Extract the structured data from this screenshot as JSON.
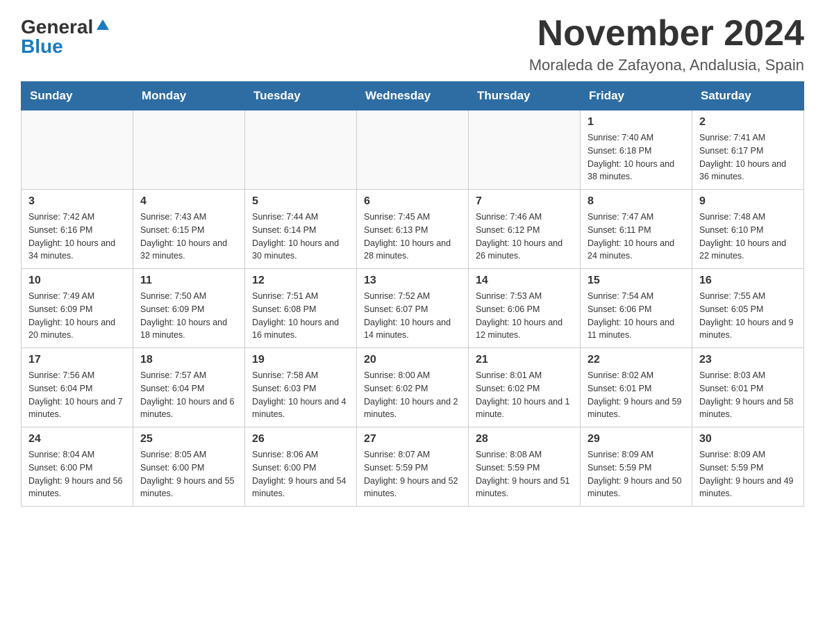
{
  "logo": {
    "general": "General",
    "blue": "Blue"
  },
  "title": "November 2024",
  "subtitle": "Moraleda de Zafayona, Andalusia, Spain",
  "days_of_week": [
    "Sunday",
    "Monday",
    "Tuesday",
    "Wednesday",
    "Thursday",
    "Friday",
    "Saturday"
  ],
  "weeks": [
    [
      {
        "day": "",
        "info": ""
      },
      {
        "day": "",
        "info": ""
      },
      {
        "day": "",
        "info": ""
      },
      {
        "day": "",
        "info": ""
      },
      {
        "day": "",
        "info": ""
      },
      {
        "day": "1",
        "info": "Sunrise: 7:40 AM\nSunset: 6:18 PM\nDaylight: 10 hours and 38 minutes."
      },
      {
        "day": "2",
        "info": "Sunrise: 7:41 AM\nSunset: 6:17 PM\nDaylight: 10 hours and 36 minutes."
      }
    ],
    [
      {
        "day": "3",
        "info": "Sunrise: 7:42 AM\nSunset: 6:16 PM\nDaylight: 10 hours and 34 minutes."
      },
      {
        "day": "4",
        "info": "Sunrise: 7:43 AM\nSunset: 6:15 PM\nDaylight: 10 hours and 32 minutes."
      },
      {
        "day": "5",
        "info": "Sunrise: 7:44 AM\nSunset: 6:14 PM\nDaylight: 10 hours and 30 minutes."
      },
      {
        "day": "6",
        "info": "Sunrise: 7:45 AM\nSunset: 6:13 PM\nDaylight: 10 hours and 28 minutes."
      },
      {
        "day": "7",
        "info": "Sunrise: 7:46 AM\nSunset: 6:12 PM\nDaylight: 10 hours and 26 minutes."
      },
      {
        "day": "8",
        "info": "Sunrise: 7:47 AM\nSunset: 6:11 PM\nDaylight: 10 hours and 24 minutes."
      },
      {
        "day": "9",
        "info": "Sunrise: 7:48 AM\nSunset: 6:10 PM\nDaylight: 10 hours and 22 minutes."
      }
    ],
    [
      {
        "day": "10",
        "info": "Sunrise: 7:49 AM\nSunset: 6:09 PM\nDaylight: 10 hours and 20 minutes."
      },
      {
        "day": "11",
        "info": "Sunrise: 7:50 AM\nSunset: 6:09 PM\nDaylight: 10 hours and 18 minutes."
      },
      {
        "day": "12",
        "info": "Sunrise: 7:51 AM\nSunset: 6:08 PM\nDaylight: 10 hours and 16 minutes."
      },
      {
        "day": "13",
        "info": "Sunrise: 7:52 AM\nSunset: 6:07 PM\nDaylight: 10 hours and 14 minutes."
      },
      {
        "day": "14",
        "info": "Sunrise: 7:53 AM\nSunset: 6:06 PM\nDaylight: 10 hours and 12 minutes."
      },
      {
        "day": "15",
        "info": "Sunrise: 7:54 AM\nSunset: 6:06 PM\nDaylight: 10 hours and 11 minutes."
      },
      {
        "day": "16",
        "info": "Sunrise: 7:55 AM\nSunset: 6:05 PM\nDaylight: 10 hours and 9 minutes."
      }
    ],
    [
      {
        "day": "17",
        "info": "Sunrise: 7:56 AM\nSunset: 6:04 PM\nDaylight: 10 hours and 7 minutes."
      },
      {
        "day": "18",
        "info": "Sunrise: 7:57 AM\nSunset: 6:04 PM\nDaylight: 10 hours and 6 minutes."
      },
      {
        "day": "19",
        "info": "Sunrise: 7:58 AM\nSunset: 6:03 PM\nDaylight: 10 hours and 4 minutes."
      },
      {
        "day": "20",
        "info": "Sunrise: 8:00 AM\nSunset: 6:02 PM\nDaylight: 10 hours and 2 minutes."
      },
      {
        "day": "21",
        "info": "Sunrise: 8:01 AM\nSunset: 6:02 PM\nDaylight: 10 hours and 1 minute."
      },
      {
        "day": "22",
        "info": "Sunrise: 8:02 AM\nSunset: 6:01 PM\nDaylight: 9 hours and 59 minutes."
      },
      {
        "day": "23",
        "info": "Sunrise: 8:03 AM\nSunset: 6:01 PM\nDaylight: 9 hours and 58 minutes."
      }
    ],
    [
      {
        "day": "24",
        "info": "Sunrise: 8:04 AM\nSunset: 6:00 PM\nDaylight: 9 hours and 56 minutes."
      },
      {
        "day": "25",
        "info": "Sunrise: 8:05 AM\nSunset: 6:00 PM\nDaylight: 9 hours and 55 minutes."
      },
      {
        "day": "26",
        "info": "Sunrise: 8:06 AM\nSunset: 6:00 PM\nDaylight: 9 hours and 54 minutes."
      },
      {
        "day": "27",
        "info": "Sunrise: 8:07 AM\nSunset: 5:59 PM\nDaylight: 9 hours and 52 minutes."
      },
      {
        "day": "28",
        "info": "Sunrise: 8:08 AM\nSunset: 5:59 PM\nDaylight: 9 hours and 51 minutes."
      },
      {
        "day": "29",
        "info": "Sunrise: 8:09 AM\nSunset: 5:59 PM\nDaylight: 9 hours and 50 minutes."
      },
      {
        "day": "30",
        "info": "Sunrise: 8:09 AM\nSunset: 5:59 PM\nDaylight: 9 hours and 49 minutes."
      }
    ]
  ]
}
